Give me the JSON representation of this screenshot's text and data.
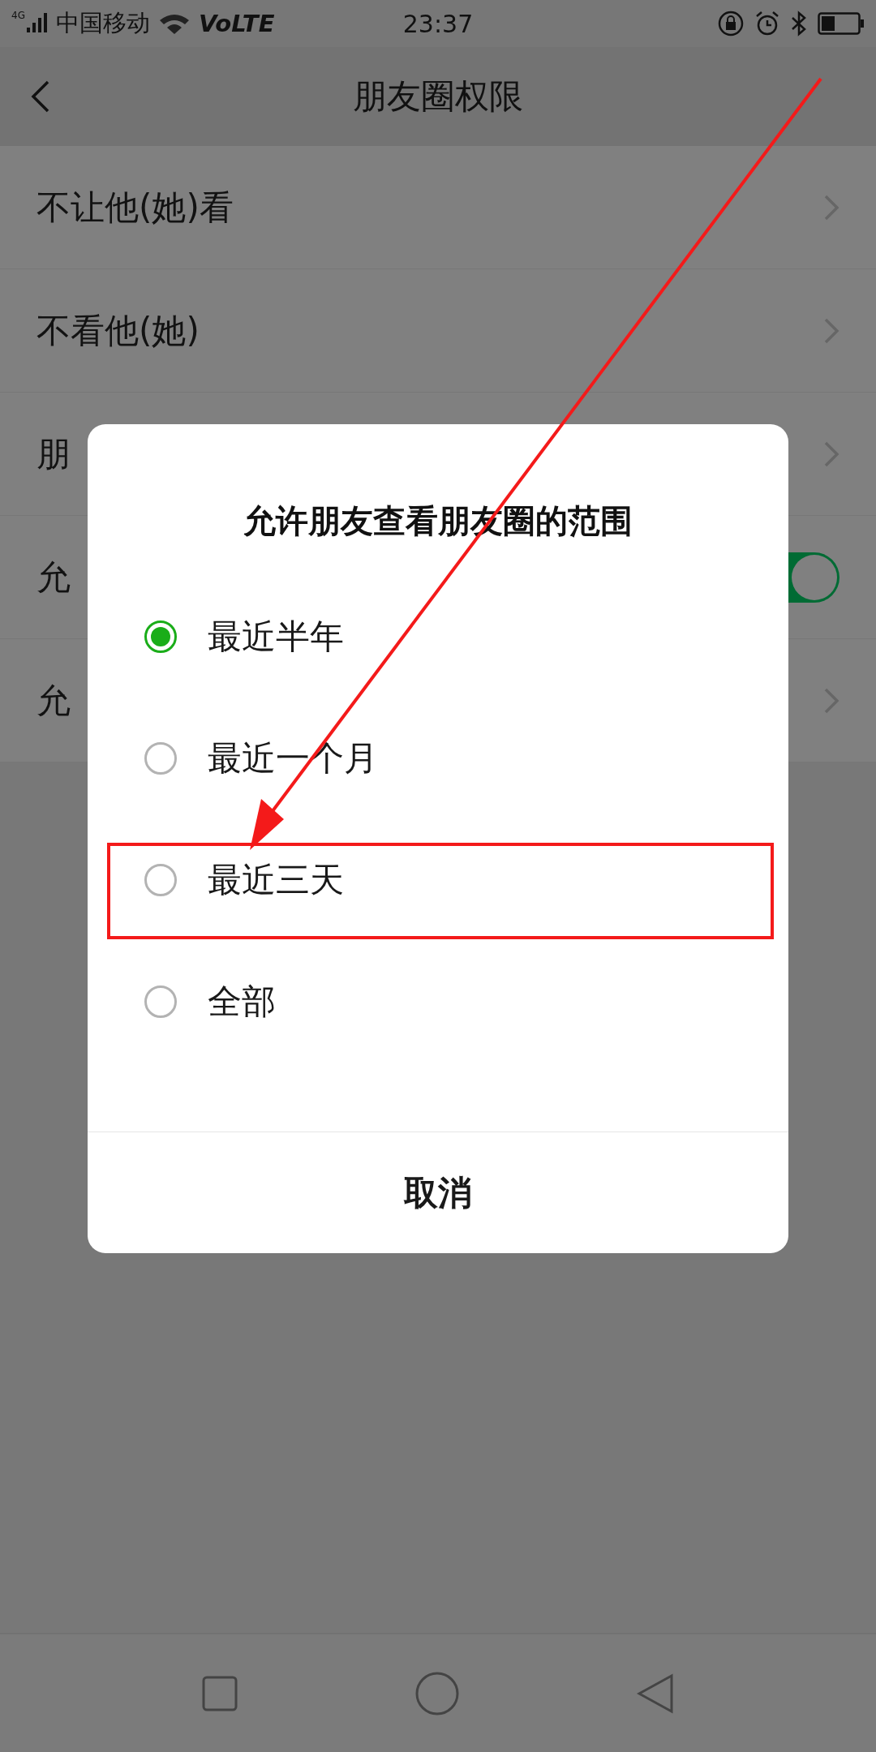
{
  "status_bar": {
    "network": "4G",
    "carrier": "中国移动",
    "volte": "VoLTE",
    "time": "23:37"
  },
  "header": {
    "title": "朋友圈权限"
  },
  "settings": [
    {
      "label": "不让他(她)看",
      "kind": "link"
    },
    {
      "label": "不看他(她)",
      "kind": "link"
    },
    {
      "label": "朋",
      "kind": "link"
    },
    {
      "label": "允",
      "kind": "toggle",
      "on": true
    },
    {
      "label": "允",
      "kind": "link"
    }
  ],
  "dialog": {
    "title": "允许朋友查看朋友圈的范围",
    "options": [
      {
        "label": "最近半年",
        "selected": true
      },
      {
        "label": "最近一个月",
        "selected": false
      },
      {
        "label": "最近三天",
        "selected": false
      },
      {
        "label": "全部",
        "selected": false
      }
    ],
    "cancel": "取消"
  }
}
